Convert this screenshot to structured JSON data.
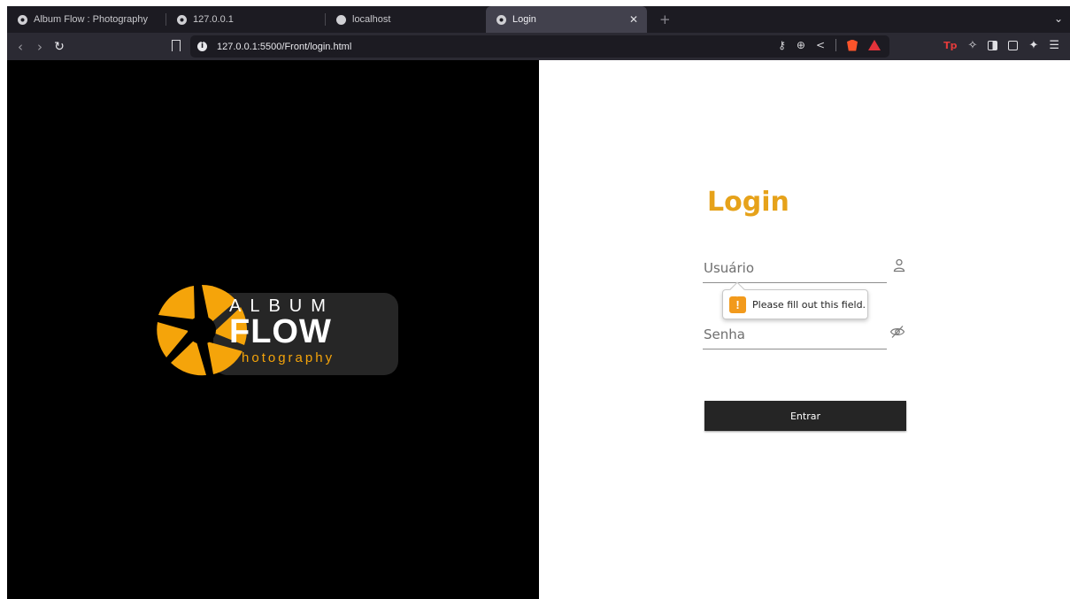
{
  "browser": {
    "tabs": [
      {
        "title": "Album Flow : Photography"
      },
      {
        "title": "127.0.0.1"
      },
      {
        "title": "localhost"
      },
      {
        "title": "Login",
        "active": true
      }
    ],
    "address": "127.0.0.1:5500/Front/login.html"
  },
  "brand": {
    "album": "ALBUM",
    "flow": "FLOW",
    "photography": "Photography",
    "accent_color": "#f5a40a"
  },
  "login": {
    "title": "Login",
    "username_placeholder": "Usuário",
    "password_placeholder": "Senha",
    "submit_label": "Entrar",
    "validation_message": "Please fill out this field.",
    "title_color": "#e6a21a"
  }
}
